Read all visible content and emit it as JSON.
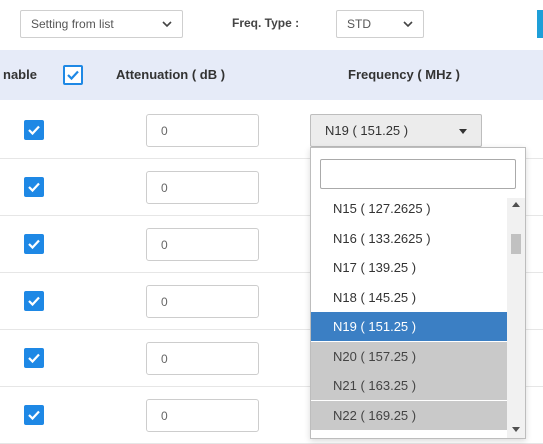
{
  "toolbar": {
    "setting_mode": "Setting from list",
    "freq_type_label": "Freq. Type :",
    "freq_type_value": "STD"
  },
  "table": {
    "headers": {
      "enable": "nable",
      "attenuation": "Attenuation ( dB )",
      "frequency": "Frequency ( MHz )"
    },
    "rows": [
      {
        "enabled": true,
        "attenuation": "0"
      },
      {
        "enabled": true,
        "attenuation": "0"
      },
      {
        "enabled": true,
        "attenuation": "0"
      },
      {
        "enabled": true,
        "attenuation": "0"
      },
      {
        "enabled": true,
        "attenuation": "0"
      },
      {
        "enabled": true,
        "attenuation": "0"
      }
    ],
    "frequency_selected": "N19 ( 151.25 )"
  },
  "dropdown": {
    "search_value": "",
    "items": [
      {
        "label": "N15 ( 127.2625 )",
        "state": "normal"
      },
      {
        "label": "N16 ( 133.2625 )",
        "state": "normal"
      },
      {
        "label": "N17 ( 139.25 )",
        "state": "normal"
      },
      {
        "label": "N18 ( 145.25 )",
        "state": "normal"
      },
      {
        "label": "N19 ( 151.25 )",
        "state": "selected"
      },
      {
        "label": "N20 ( 157.25 )",
        "state": "disabled"
      },
      {
        "label": "N21 ( 163.25 )",
        "state": "disabled"
      },
      {
        "label": "N22 ( 169.25 )",
        "state": "disabled"
      }
    ]
  },
  "colors": {
    "accent": "#1e88e5",
    "header_bg": "#e6ebf8",
    "selected": "#3b7fc4",
    "disabled": "#c9c9c9"
  },
  "icons": {
    "checkbox": "check-icon",
    "select": "chevron-down-icon"
  }
}
